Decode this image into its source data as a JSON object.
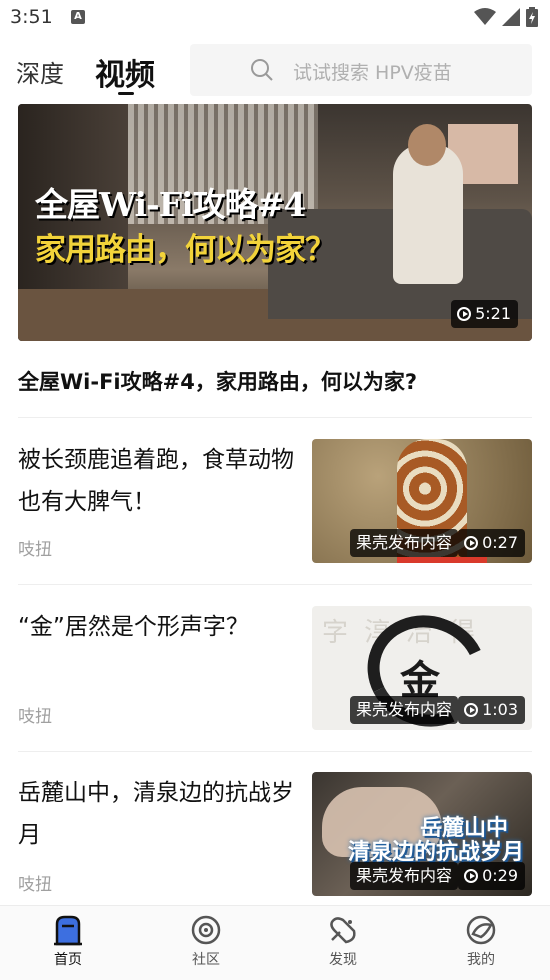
{
  "status_bar": {
    "time": "3:51",
    "notification_icon": "a-icon"
  },
  "top_tabs": [
    {
      "label": "深度"
    },
    {
      "label": "视频"
    }
  ],
  "search": {
    "placeholder": "试试搜索 HPV疫苗"
  },
  "hero": {
    "overlay_line1": "全屋Wi-Fi攻略#4",
    "overlay_line2": "家用路由，何以为家？",
    "duration": "5:21",
    "title": "全屋Wi-Fi攻略#4，家用路由，何以为家?"
  },
  "items": [
    {
      "title": "被长颈鹿追着跑，食草动物也有大脾气！",
      "source": "吱扭",
      "badge": "果壳发布内容",
      "duration": "0:27"
    },
    {
      "title": "“金”居然是个形声字？",
      "source": "吱扭",
      "badge": "果壳发布内容",
      "duration": "1:03",
      "thumb_char": "金"
    },
    {
      "title": "岳麓山中，清泉边的抗战岁月",
      "source": "吱扭",
      "badge": "果壳发布内容",
      "duration": "0:29",
      "thumb_line1": "岳麓山中",
      "thumb_line2": "清泉边的抗战岁月"
    }
  ],
  "bottom_nav": [
    {
      "label": "首页",
      "icon": "home-icon",
      "active": true
    },
    {
      "label": "社区",
      "icon": "community-icon",
      "active": false
    },
    {
      "label": "发现",
      "icon": "discover-icon",
      "active": false
    },
    {
      "label": "我的",
      "icon": "profile-icon",
      "active": false
    }
  ],
  "colors": {
    "accent": "#111111",
    "hero_highlight": "#f2d33a",
    "nav_active_fill": "#3d6fe0"
  }
}
